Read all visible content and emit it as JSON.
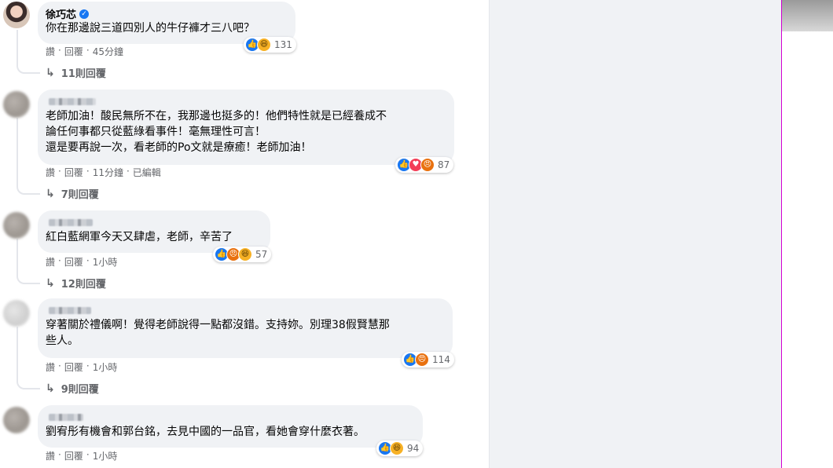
{
  "comments": [
    {
      "author": "徐巧芯",
      "text": "你在那邊說三道四別人的牛仔褲才三八吧？",
      "meta": {
        "like": "讚",
        "reply": "回覆",
        "time": "45分鐘"
      },
      "reactions": {
        "icons": [
          "like-icon",
          "haha-icon"
        ],
        "count": "131"
      },
      "replies": "11則回覆"
    },
    {
      "author": "",
      "text": "老師加油！酸民無所不在，我那邊也挺多的！他們特性就是已經養成不\n論任何事都只從藍綠看事件！毫無理性可言！\n還是要再說一次，看老師的Po文就是療癒！老師加油！",
      "meta": {
        "like": "讚",
        "reply": "回覆",
        "time": "11分鐘",
        "edited": "已編輯"
      },
      "reactions": {
        "icons": [
          "like-icon",
          "love-icon",
          "angry-icon"
        ],
        "count": "87"
      },
      "replies": "7則回覆"
    },
    {
      "author": "",
      "text": "紅白藍網軍今天又肆虐，老師，辛苦了",
      "meta": {
        "like": "讚",
        "reply": "回覆",
        "time": "1小時"
      },
      "reactions": {
        "icons": [
          "like-icon",
          "angry-icon",
          "haha-icon"
        ],
        "count": "57"
      },
      "replies": "12則回覆"
    },
    {
      "author": "",
      "text": "穿著關於禮儀啊！覺得老師說得一點都沒錯。支持妳。別理38假賢慧那\n些人。",
      "meta": {
        "like": "讚",
        "reply": "回覆",
        "time": "1小時"
      },
      "reactions": {
        "icons": [
          "like-icon",
          "angry-icon"
        ],
        "count": "114"
      },
      "replies": "9則回覆"
    },
    {
      "author": "",
      "text": "劉宥彤有機會和郭台銘，去見中國的一品官，看她會穿什麼衣著。",
      "meta": {
        "like": "讚",
        "reply": "回覆",
        "time": "1小時"
      },
      "reactions": {
        "icons": [
          "like-icon",
          "haha-icon"
        ],
        "count": "94"
      },
      "replies": ""
    }
  ],
  "sep": "·",
  "colors": {
    "like": "#1877f2",
    "love": "#f33e58",
    "haha": "#f7b125",
    "angry": "#e9710f",
    "bubble": "#f0f2f5"
  }
}
